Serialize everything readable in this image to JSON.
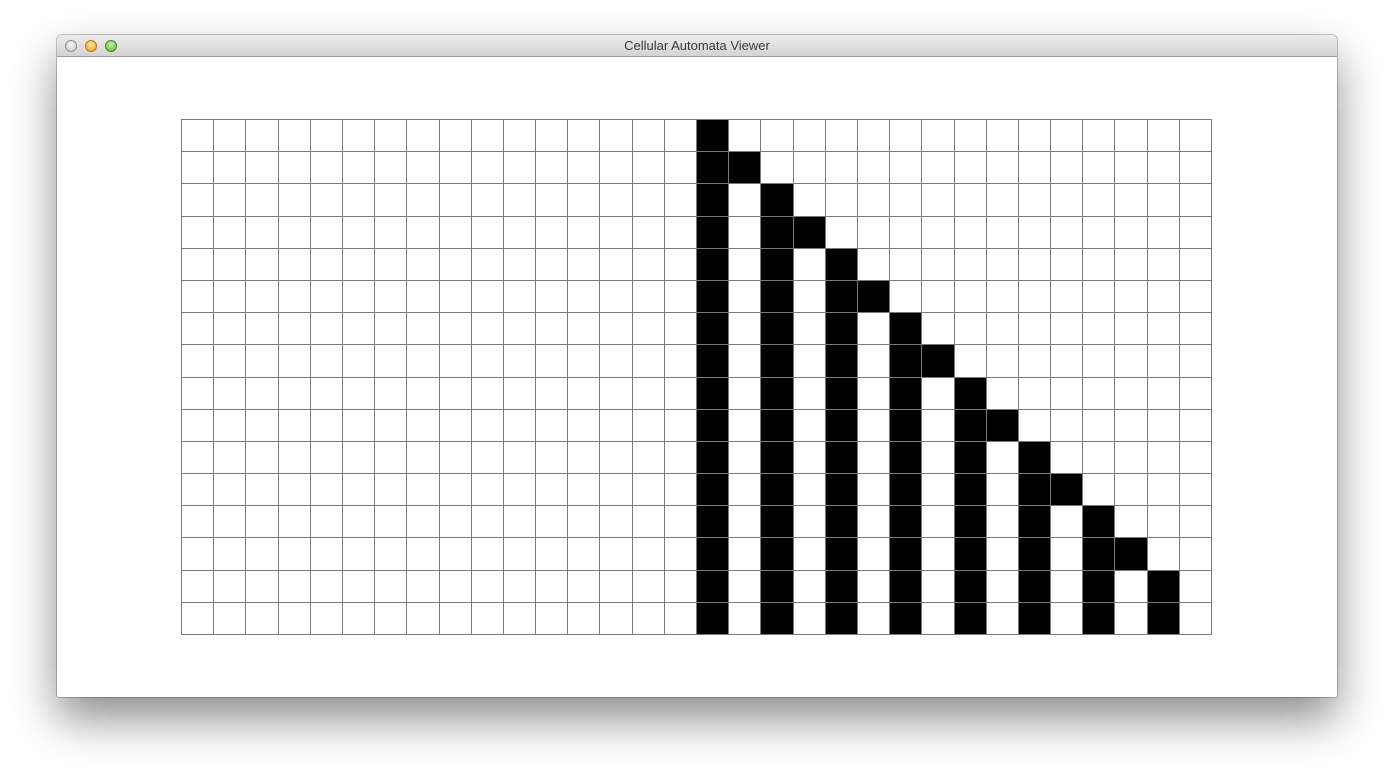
{
  "window": {
    "title": "Cellular Automata Viewer"
  },
  "titlebar_buttons": [
    {
      "name": "close-button",
      "color": "#c9c9c9"
    },
    {
      "name": "minimize-button",
      "color": "#e9a21f"
    },
    {
      "name": "zoom-button",
      "color": "#5fb43a"
    }
  ],
  "automaton": {
    "columns": 32,
    "rows": 16,
    "alive_color": "#000000",
    "dead_color": "#ffffff",
    "grid_line_color": "#7a7a7a",
    "cells": [
      "0000000000000000100000000000000",
      "0000000000000000110000000000000",
      "0000000000000000101000000000000",
      "0000000000000000101100000000000",
      "0000000000000000101010000000000",
      "0000000000000000101011000000000",
      "0000000000000000101010100000000",
      "0000000000000000101010110000000",
      "0000000000000000101010101000000",
      "0000000000000000101010101100000",
      "0000000000000000101010101010000",
      "0000000000000000101010101011000",
      "0000000000000000101010101010100",
      "0000000000000000101010101010110",
      "0000000000000000101010101010101",
      "0000000000000000101010101010101"
    ]
  }
}
